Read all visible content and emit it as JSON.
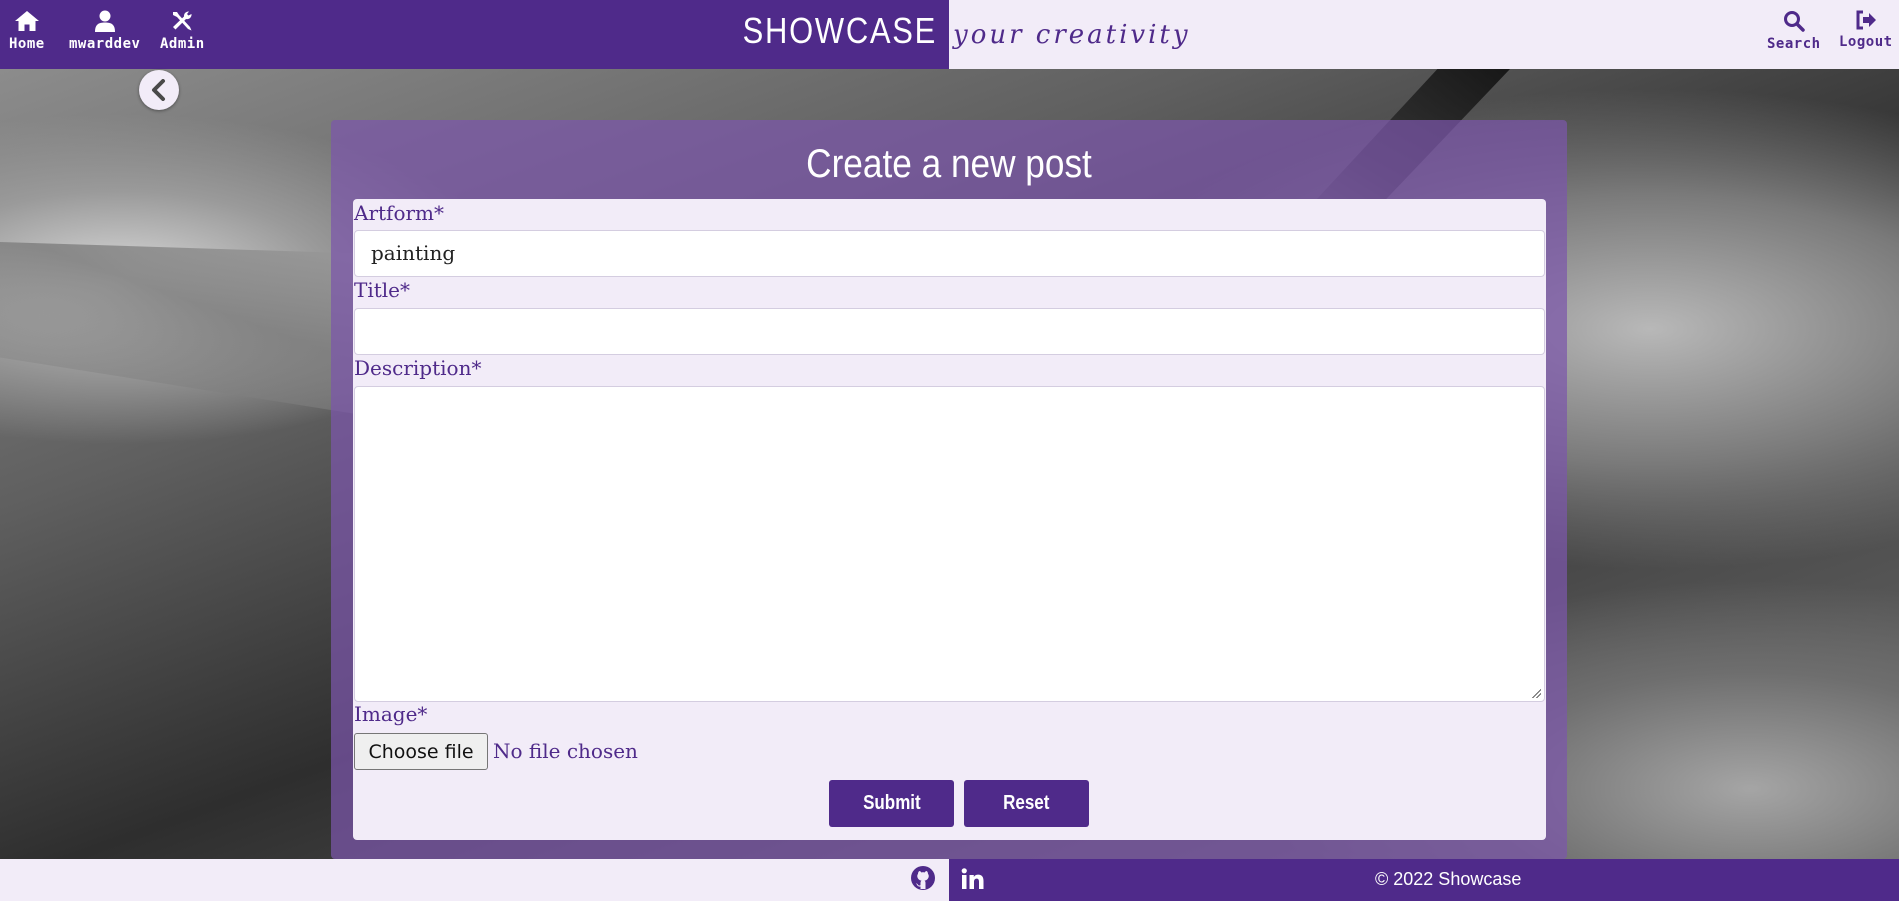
{
  "colors": {
    "brand_purple": "#4f2a8a",
    "light_lavender": "#f2ecf8",
    "card_overlay": "#7b56aa"
  },
  "header": {
    "nav": [
      {
        "label": "Home",
        "icon": "home-icon"
      },
      {
        "label": "mwarddev",
        "icon": "user-icon"
      },
      {
        "label": "Admin",
        "icon": "tools-icon"
      }
    ],
    "brand": "SHOWCASE",
    "tagline": "your creativity",
    "right_nav": [
      {
        "label": "Search",
        "icon": "search-icon"
      },
      {
        "label": "Logout",
        "icon": "logout-icon"
      }
    ]
  },
  "back_button": {
    "icon": "chevron-left-icon"
  },
  "form": {
    "title": "Create a new post",
    "artform": {
      "label": "Artform*",
      "value": "painting"
    },
    "title_field": {
      "label": "Title*",
      "value": ""
    },
    "description": {
      "label": "Description*",
      "value": ""
    },
    "image": {
      "label": "Image*",
      "button": "Choose file",
      "status": "No file chosen"
    },
    "submit": "Submit",
    "reset": "Reset"
  },
  "footer": {
    "icons": [
      "github-icon",
      "linkedin-icon"
    ],
    "copyright": "© 2022 Showcase"
  }
}
